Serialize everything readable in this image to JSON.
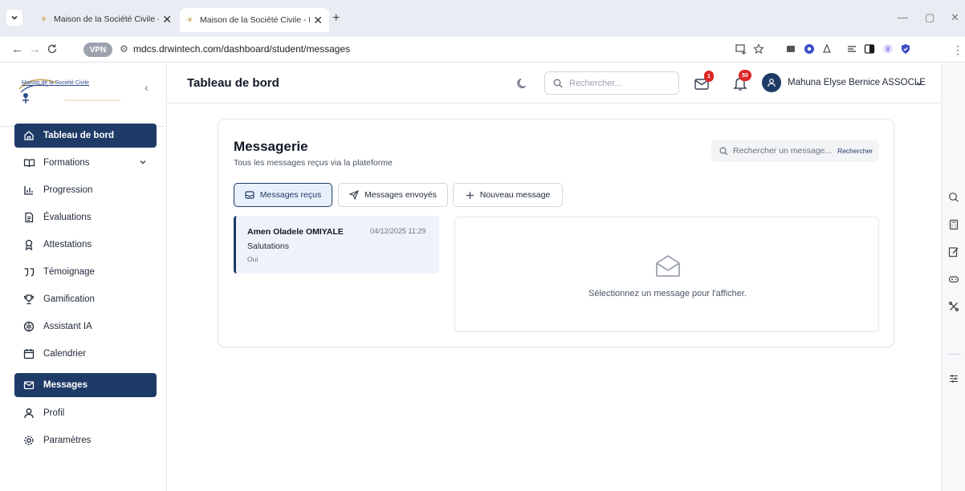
{
  "browser": {
    "tabs": [
      {
        "title": "Maison de la Société Civile - Pla",
        "active": false
      },
      {
        "title": "Maison de la Société Civile - Pla",
        "active": true
      }
    ],
    "vpn_label": "VPN",
    "url": "mdcs.drwintech.com/dashboard/student/messages"
  },
  "sidebar": {
    "logo_text": "Maison de la Société Civile",
    "items": [
      {
        "label": "Tableau de bord",
        "icon": "home-icon",
        "active": true
      },
      {
        "label": "Formations",
        "icon": "book-icon",
        "active": false,
        "expandable": true
      },
      {
        "label": "Progression",
        "icon": "bar-chart-icon",
        "active": false
      },
      {
        "label": "Évaluations",
        "icon": "clipboard-icon",
        "active": false
      },
      {
        "label": "Attestations",
        "icon": "award-icon",
        "active": false
      },
      {
        "label": "Témoignage",
        "icon": "quote-icon",
        "active": false
      },
      {
        "label": "Gamification",
        "icon": "trophy-icon",
        "active": false
      },
      {
        "label": "Assistant IA",
        "icon": "brain-icon",
        "active": false
      },
      {
        "label": "Calendrier",
        "icon": "calendar-icon",
        "active": false
      },
      {
        "label": "Messages",
        "icon": "mail-icon",
        "active": true
      },
      {
        "label": "Profil",
        "icon": "user-icon",
        "active": false
      },
      {
        "label": "Paramètres",
        "icon": "settings-icon",
        "active": false
      }
    ]
  },
  "header": {
    "title": "Tableau de bord",
    "search_placeholder": "Rechercher...",
    "mail_badge": "1",
    "notif_badge": "50",
    "user_name": "Mahuna Elyse Bernice ASSOCLE"
  },
  "messagerie": {
    "title": "Messagerie",
    "subtitle": "Tous les messages reçus via la plateforme",
    "search_placeholder": "Rechercher un message...",
    "search_button": "Rechercher",
    "tabs": [
      {
        "label": "Messages reçus",
        "icon": "inbox-icon",
        "active": true
      },
      {
        "label": "Messages envoyés",
        "icon": "send-icon",
        "active": false
      },
      {
        "label": "Nouveau message",
        "icon": "plus-icon",
        "active": false
      }
    ],
    "messages": [
      {
        "from": "Amen Oladele OMIYALE",
        "date": "04/12/2025 11:29",
        "subject": "Salutations",
        "preview": "Oui"
      }
    ],
    "empty_hint": "Sélectionnez un message pour l'afficher."
  },
  "colors": {
    "primary": "#1e3a66",
    "badge": "#dc2626",
    "selected_bg": "#eef3fb"
  }
}
